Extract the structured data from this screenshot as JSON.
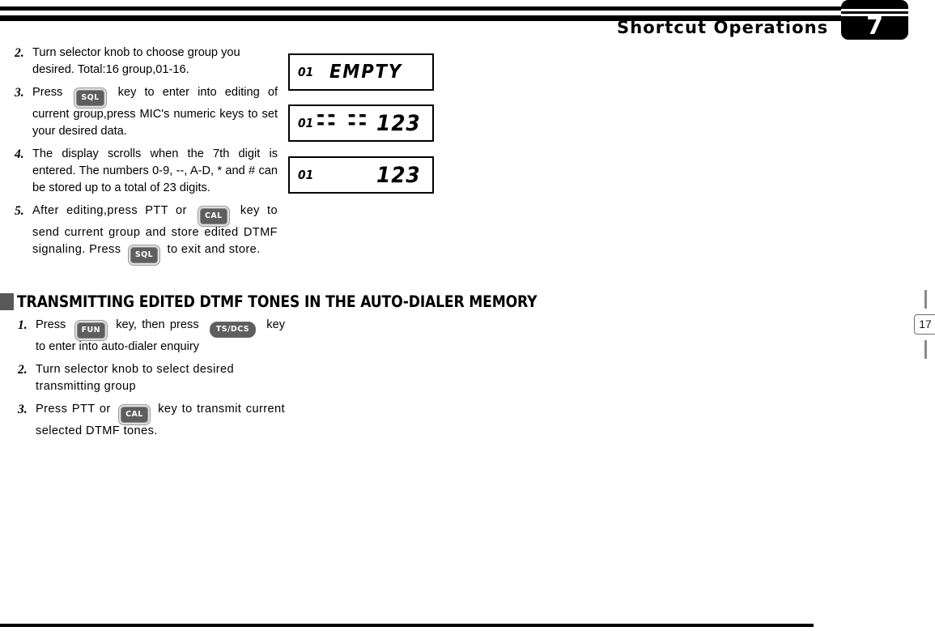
{
  "header": {
    "title": "Shortcut Operations",
    "chapter_number": "7"
  },
  "page": {
    "number": "17"
  },
  "steps_top": [
    {
      "num": "2.",
      "lines": [
        "Turn selector knob to choose group you",
        "desired. Total:16 group,01-16."
      ]
    },
    {
      "num": "3.",
      "lines_pre": "Press ",
      "key": "SQL",
      "lines_post": " key to enter into editing of current group,press MIC's  numeric keys to set your desired data."
    },
    {
      "num": "4.",
      "lines": [
        "The display scrolls when the 7th digit is entered. The numbers 0-9, --, A-D, * and # can be stored up to a total of 23 digits."
      ]
    },
    {
      "num": "5.",
      "seg1": "After editing,press PTT or ",
      "key1": "CAL",
      "seg2": " key to send current group and store edited DTMF signaling. Press ",
      "key2": "SQL",
      "seg3": " to exit and store."
    }
  ],
  "lcd_displays": [
    {
      "group": "01",
      "text": "EMPTY",
      "dashes": ""
    },
    {
      "group": "01",
      "text": "123",
      "dashes": "-- -- -- --"
    },
    {
      "group": "01",
      "text": "123",
      "dashes": ""
    }
  ],
  "section": {
    "bullet": "square-bullet",
    "title": "TRANSMITTING EDITED DTMF TONES IN THE AUTO-DIALER MEMORY"
  },
  "steps_bottom": [
    {
      "num": "1.",
      "seg1": "Press ",
      "key1": "FUN",
      "seg2": " key, then press ",
      "key2": "TS/DCS",
      "seg3": " key to enter into auto-dialer enquiry"
    },
    {
      "num": "2.",
      "lines": [
        "Turn selector knob to select desired",
        "transmitting group"
      ]
    },
    {
      "num": "3.",
      "seg1": "Press PTT or ",
      "key1": "CAL",
      "seg2": " key to transmit current selected DTMF tones."
    }
  ],
  "colors": {
    "rule": "#000000",
    "bullet": "#595959",
    "keycap_face": "#5e5e5e",
    "pagemark_border": "#6d6d6d"
  }
}
